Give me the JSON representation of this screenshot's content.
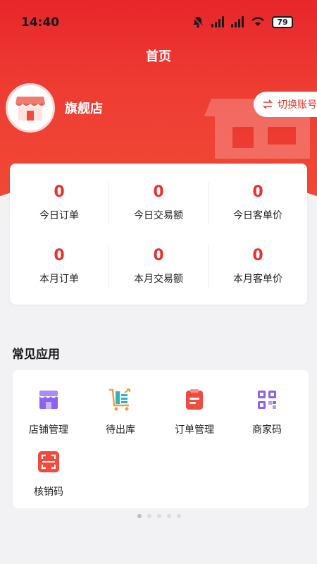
{
  "status_bar": {
    "time": "14:40",
    "battery": "79"
  },
  "header": {
    "title": "首页"
  },
  "shop": {
    "name": "旗舰店",
    "switch_label": "切换账号"
  },
  "stats": [
    {
      "value": "0",
      "label": "今日订单"
    },
    {
      "value": "0",
      "label": "今日交易额"
    },
    {
      "value": "0",
      "label": "今日客单价"
    },
    {
      "value": "0",
      "label": "本月订单"
    },
    {
      "value": "0",
      "label": "本月交易额"
    },
    {
      "value": "0",
      "label": "本月客单价"
    }
  ],
  "apps_section": {
    "title": "常见应用",
    "items": [
      {
        "label": "店铺管理",
        "icon": "store-icon"
      },
      {
        "label": "待出库",
        "icon": "cart-export-icon"
      },
      {
        "label": "订单管理",
        "icon": "order-list-icon"
      },
      {
        "label": "商家码",
        "icon": "qr-code-icon"
      },
      {
        "label": "核销码",
        "icon": "scan-code-icon"
      }
    ]
  },
  "pager": {
    "count": 5,
    "active": 0
  },
  "colors": {
    "brand_red": "#e8262b",
    "value_red": "#e5322e",
    "switch_text": "#e53a30"
  }
}
